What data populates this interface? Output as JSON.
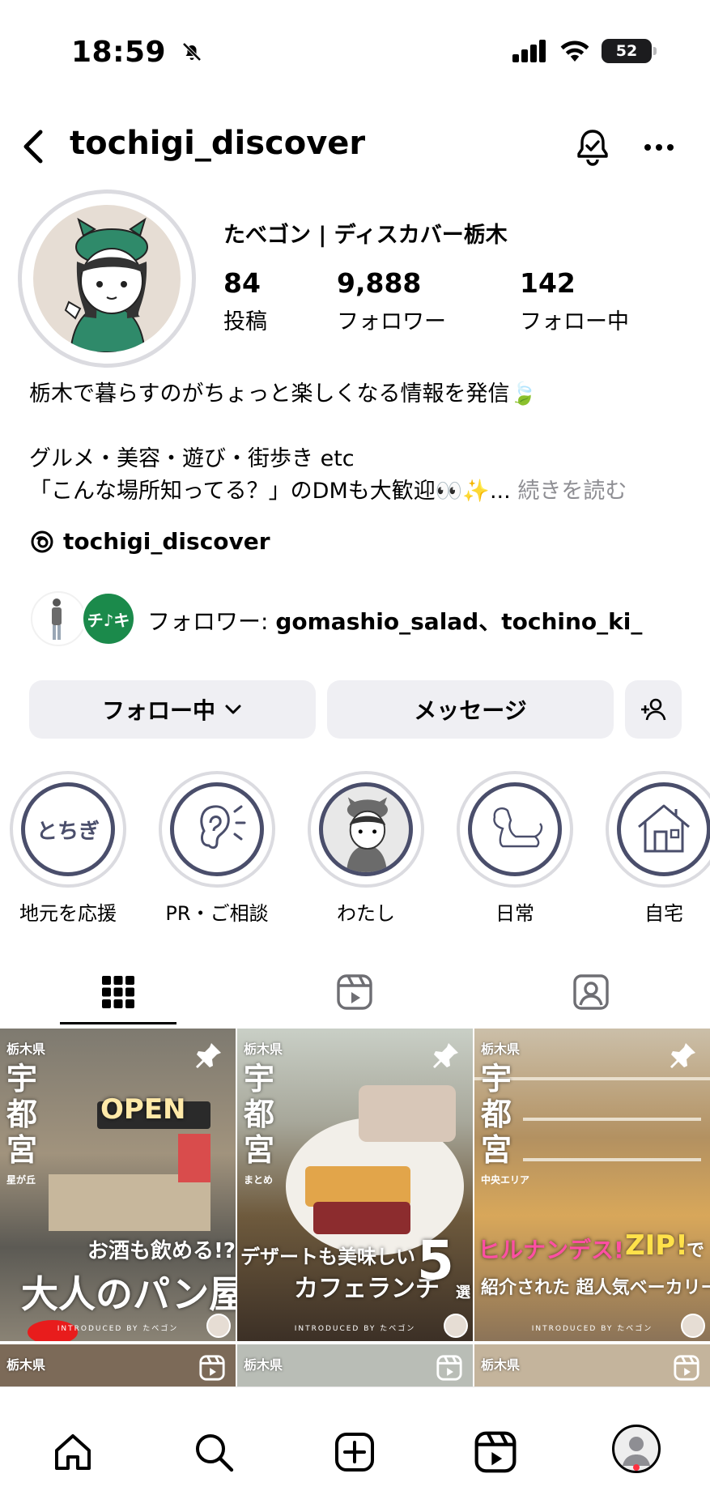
{
  "status": {
    "time": "18:59",
    "battery": "52"
  },
  "header": {
    "username": "tochigi_discover"
  },
  "profile": {
    "display_name": "たべゴン | ディスカバー栃木",
    "stats": [
      {
        "value": "84",
        "label": "投稿"
      },
      {
        "value": "9,888",
        "label": "フォロワー"
      },
      {
        "value": "142",
        "label": "フォロー中"
      }
    ],
    "bio_line1": "栃木で暮らすのがちょっと楽しくなる情報を発信🍃",
    "bio_line2": "グルメ・美容・遊び・街歩き etc",
    "bio_line3": "「こんな場所知ってる？」のDMも大歓迎👀✨...",
    "bio_more": "続きを読む",
    "threads_handle": "tochigi_discover",
    "followed_by_prefix": "フォロワー: ",
    "followed_by_names": "gomashio_salad、tochino_ki_",
    "followed_avatar2_text": "チ♪キ"
  },
  "buttons": {
    "following": "フォロー中",
    "message": "メッセージ"
  },
  "highlights": [
    {
      "label": "地元を応援",
      "icon_text": "とちぎ",
      "icon": "tochigi-text-icon"
    },
    {
      "label": "PR・ご相談",
      "icon": "ear-icon"
    },
    {
      "label": "わたし",
      "icon": "character-icon"
    },
    {
      "label": "日常",
      "icon": "dog-icon"
    },
    {
      "label": "自宅",
      "icon": "house-icon"
    }
  ],
  "posts": [
    {
      "pref": "栃木県",
      "city": "宇都宮",
      "sub": "星が丘",
      "sign": "OPEN",
      "cap1": "お酒も飲める!?",
      "cap2": "大人のパン屋",
      "intro": "INTRODUCED BY たべゴン"
    },
    {
      "pref": "栃木県",
      "city": "宇都宮",
      "sub": "まとめ",
      "cap1": "デザートも美味しい",
      "cap2": "カフェランチ",
      "number": "5",
      "cap3": "選",
      "intro": "INTRODUCED BY たべゴン"
    },
    {
      "pref": "栃木県",
      "city": "宇都宮",
      "sub": "中央エリア",
      "cap1": "ヒルナンデス!",
      "cap1b": "ZIP!",
      "cap1c": "で",
      "cap2": "紹介された 超人気ベーカリー",
      "intro": "INTRODUCED BY たべゴン"
    }
  ],
  "posts_row2": [
    {
      "pref": "栃木県"
    },
    {
      "pref": "栃木県"
    },
    {
      "pref": "栃木県"
    }
  ],
  "colors": {
    "accent_button_bg": "#efeff3",
    "highlight_stroke": "#4a4e6b",
    "notification": "#ff3040"
  }
}
